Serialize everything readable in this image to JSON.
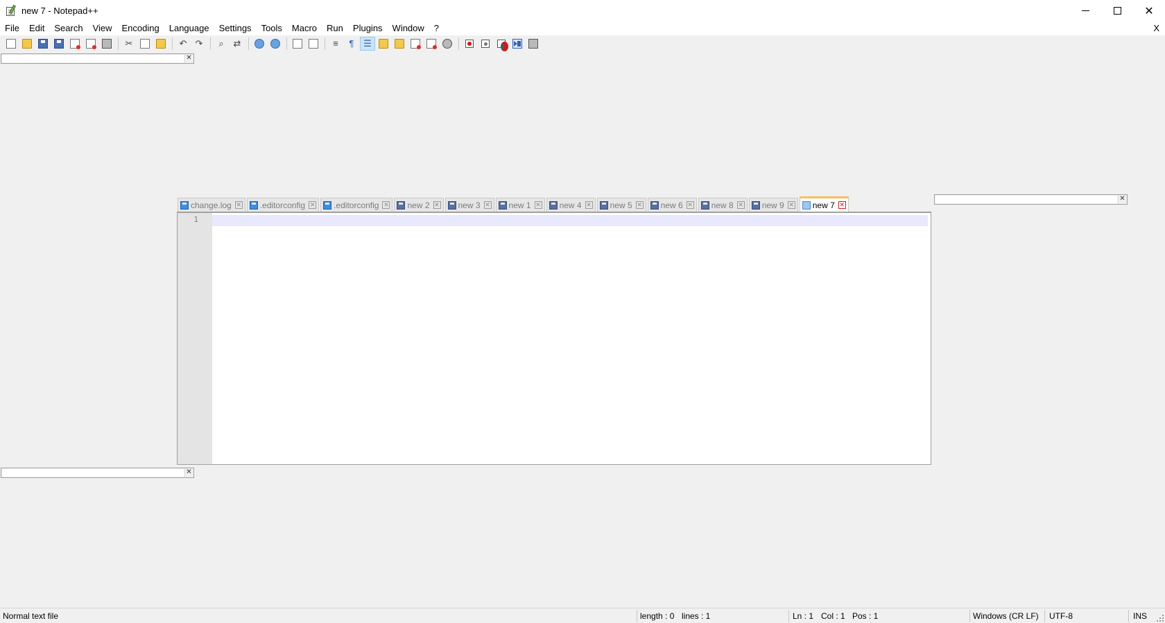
{
  "window": {
    "title": "new 7 - Notepad++",
    "controls": {
      "close": "✕"
    }
  },
  "menu": {
    "items": [
      "File",
      "Edit",
      "Search",
      "View",
      "Encoding",
      "Language",
      "Settings",
      "Tools",
      "Macro",
      "Run",
      "Plugins",
      "Window",
      "?"
    ],
    "close_label": "X"
  },
  "toolbar": {
    "buttons": [
      {
        "name": "new-file-icon"
      },
      {
        "name": "open-file-icon"
      },
      {
        "name": "save-icon"
      },
      {
        "name": "save-all-icon"
      },
      {
        "name": "close-icon"
      },
      {
        "name": "close-all-icon"
      },
      {
        "name": "print-icon"
      },
      {
        "name": "cut-icon"
      },
      {
        "name": "copy-icon"
      },
      {
        "name": "paste-icon"
      },
      {
        "name": "undo-icon"
      },
      {
        "name": "redo-icon"
      },
      {
        "name": "find-icon"
      },
      {
        "name": "replace-icon"
      },
      {
        "name": "zoom-in-icon"
      },
      {
        "name": "zoom-out-icon"
      },
      {
        "name": "sync-vertical-icon"
      },
      {
        "name": "sync-horizontal-icon"
      },
      {
        "name": "word-wrap-icon"
      },
      {
        "name": "show-all-characters-icon"
      },
      {
        "name": "indent-guide-icon",
        "pressed": true
      },
      {
        "name": "function-list-icon"
      },
      {
        "name": "document-map-icon"
      },
      {
        "name": "folder-as-workspace-icon"
      },
      {
        "name": "document-list-icon"
      },
      {
        "name": "monitoring-icon"
      },
      {
        "name": "record-macro-icon"
      },
      {
        "name": "stop-recording-icon"
      },
      {
        "name": "playback-macro-icon"
      },
      {
        "name": "run-macro-multiple-icon"
      },
      {
        "name": "save-macro-icon"
      }
    ],
    "pilcrow": "¶"
  },
  "dock_close_glyph": "✕",
  "tabs": [
    {
      "label": "change.log",
      "state": "saved",
      "close": "✕"
    },
    {
      "label": ".editorconfig",
      "state": "saved",
      "close": "✕"
    },
    {
      "label": ".editorconfig",
      "state": "saved",
      "close": "✕"
    },
    {
      "label": "new 2",
      "state": "unsaved",
      "close": "✕"
    },
    {
      "label": "new 3",
      "state": "unsaved",
      "close": "✕"
    },
    {
      "label": "new 1",
      "state": "unsaved",
      "close": "✕"
    },
    {
      "label": "new 4",
      "state": "unsaved",
      "close": "✕"
    },
    {
      "label": "new 5",
      "state": "unsaved",
      "close": "✕"
    },
    {
      "label": "new 6",
      "state": "unsaved",
      "close": "✕"
    },
    {
      "label": "new 8",
      "state": "unsaved",
      "close": "✕"
    },
    {
      "label": "new 9",
      "state": "unsaved",
      "close": "✕"
    },
    {
      "label": "new 7",
      "state": "active",
      "close": "✕"
    }
  ],
  "editor": {
    "line_numbers": [
      "1"
    ],
    "content": ""
  },
  "statusbar": {
    "file_type": "Normal text file",
    "length": "length : 0",
    "lines": "lines : 1",
    "ln": "Ln : 1",
    "col": "Col : 1",
    "pos": "Pos : 1",
    "eol": "Windows (CR LF)",
    "encoding": "UTF-8",
    "mode": "INS"
  },
  "colors": {
    "active_tab_accent": "#fabd59",
    "current_line": "#e8e8ff",
    "gutter": "#e4e4e4"
  }
}
